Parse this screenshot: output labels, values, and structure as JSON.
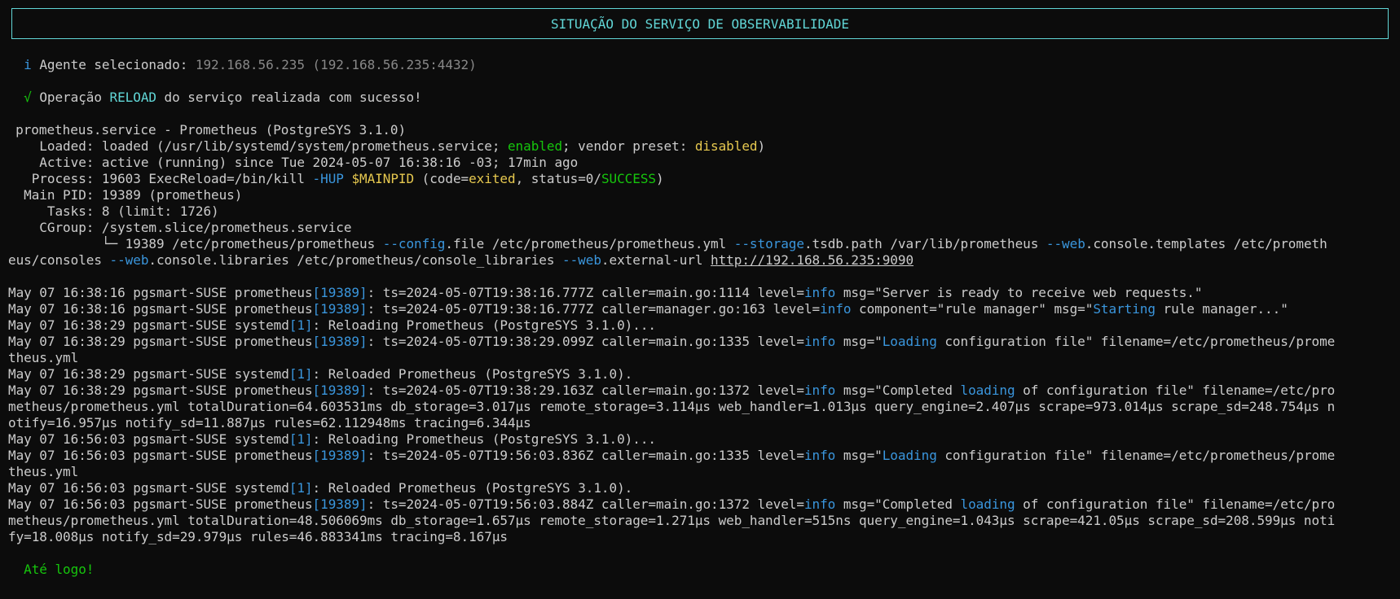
{
  "header": {
    "title": "SITUAÇÃO DO SERVIÇO DE OBSERVABILIDADE"
  },
  "info": {
    "icon": "i",
    "label": "Agente selecionado: ",
    "agent": "192.168.56.235 (192.168.56.235:4432)"
  },
  "success": {
    "icon": "√",
    "pre": "Operação ",
    "op": "RELOAD",
    "post": " do serviço realizada com sucesso!"
  },
  "status": {
    "dot": "●",
    "service_line": "prometheus.service - Prometheus (PostgreSYS 3.1.0)",
    "loaded_label": "    Loaded: ",
    "loaded_pre": "loaded (/usr/lib/systemd/system/prometheus.service; ",
    "loaded_enabled": "enabled",
    "loaded_mid": "; vendor preset: ",
    "loaded_preset": "disabled",
    "loaded_post": ")",
    "active_line": "    Active: active (running) since Tue 2024-05-07 16:38:16 -03; 17min ago",
    "process_pre": "   Process: 19603 ExecReload=/bin/kill ",
    "process_hup": "-HUP",
    "process_sp": " ",
    "process_var": "$MAINPID",
    "process_mid1": " (code=",
    "process_code": "exited",
    "process_mid2": ", status=0/",
    "process_status": "SUCCESS",
    "process_post": ")",
    "mainpid_line": "  Main PID: 19389 (prometheus)",
    "tasks_line": "     Tasks: 8 (limit: 1726)",
    "cgroup_line": "    CGroup: /system.slice/prometheus.service",
    "cmd_l1_a": "            └─ 19389 /etc/prometheus/prometheus ",
    "cmd_l1_b": "--config",
    "cmd_l1_c": ".file /etc/prometheus/prometheus.yml ",
    "cmd_l1_d": "--storage",
    "cmd_l1_e": ".tsdb.path /var/lib/prometheus ",
    "cmd_l1_f": "--web",
    "cmd_l1_g": ".console.templates /etc/prometh",
    "cmd_l2_a": "eus/consoles ",
    "cmd_l2_b": "--web",
    "cmd_l2_c": ".console.libraries /etc/prometheus/console_libraries ",
    "cmd_l2_d": "--web",
    "cmd_l2_e": ".external-url ",
    "cmd_url": "http://192.168.56.235:9090"
  },
  "log": {
    "l1_a": "May 07 16:38:16 pgsmart-SUSE prometheus",
    "l1_pid": "[19389]",
    "l1_b": ": ts=2024-05-07T19:38:16.777Z caller=main.go:1114 level=",
    "l1_lvl": "info",
    "l1_c": " msg=\"Server is ready to receive web requests.\"",
    "l2_a": "May 07 16:38:16 pgsmart-SUSE prometheus",
    "l2_pid": "[19389]",
    "l2_b": ": ts=2024-05-07T19:38:16.777Z caller=manager.go:163 level=",
    "l2_lvl": "info",
    "l2_c": " component=\"rule manager\" msg=\"",
    "l2_kw": "Starting",
    "l2_d": " rule manager...\"",
    "l3_a": "May 07 16:38:29 pgsmart-SUSE systemd",
    "l3_pid": "[1]",
    "l3_b": ": Reloading Prometheus (PostgreSYS 3.1.0)...",
    "l4_a": "May 07 16:38:29 pgsmart-SUSE prometheus",
    "l4_pid": "[19389]",
    "l4_b": ": ts=2024-05-07T19:38:29.099Z caller=main.go:1335 level=",
    "l4_lvl": "info",
    "l4_c": " msg=\"",
    "l4_kw": "Loading",
    "l4_d": " configuration file\" filename=/etc/prometheus/prome",
    "l4_wrap": "theus.yml",
    "l5_a": "May 07 16:38:29 pgsmart-SUSE systemd",
    "l5_pid": "[1]",
    "l5_b": ": Reloaded Prometheus (PostgreSYS 3.1.0).",
    "l6_a": "May 07 16:38:29 pgsmart-SUSE prometheus",
    "l6_pid": "[19389]",
    "l6_b": ": ts=2024-05-07T19:38:29.163Z caller=main.go:1372 level=",
    "l6_lvl": "info",
    "l6_c": " msg=\"Completed ",
    "l6_kw": "loading",
    "l6_d": " of configuration file\" filename=/etc/pro",
    "l6_wrap1": "metheus/prometheus.yml totalDuration=64.603531ms db_storage=3.017µs remote_storage=3.114µs web_handler=1.013µs query_engine=2.407µs scrape=973.014µs scrape_sd=248.754µs n",
    "l6_wrap2": "otify=16.957µs notify_sd=11.887µs rules=62.112948ms tracing=6.344µs",
    "l7_a": "May 07 16:56:03 pgsmart-SUSE systemd",
    "l7_pid": "[1]",
    "l7_b": ": Reloading Prometheus (PostgreSYS 3.1.0)...",
    "l8_a": "May 07 16:56:03 pgsmart-SUSE prometheus",
    "l8_pid": "[19389]",
    "l8_b": ": ts=2024-05-07T19:56:03.836Z caller=main.go:1335 level=",
    "l8_lvl": "info",
    "l8_c": " msg=\"",
    "l8_kw": "Loading",
    "l8_d": " configuration file\" filename=/etc/prometheus/prome",
    "l8_wrap": "theus.yml",
    "l9_a": "May 07 16:56:03 pgsmart-SUSE systemd",
    "l9_pid": "[1]",
    "l9_b": ": Reloaded Prometheus (PostgreSYS 3.1.0).",
    "l10_a": "May 07 16:56:03 pgsmart-SUSE prometheus",
    "l10_pid": "[19389]",
    "l10_b": ": ts=2024-05-07T19:56:03.884Z caller=main.go:1372 level=",
    "l10_lvl": "info",
    "l10_c": " msg=\"Completed ",
    "l10_kw": "loading",
    "l10_d": " of configuration file\" filename=/etc/pro",
    "l10_wrap1": "metheus/prometheus.yml totalDuration=48.506069ms db_storage=1.657µs remote_storage=1.271µs web_handler=515ns query_engine=1.043µs scrape=421.05µs scrape_sd=208.599µs noti",
    "l10_wrap2": "fy=18.008µs notify_sd=29.979µs rules=46.883341ms tracing=8.167µs"
  },
  "footer": {
    "goodbye": "Até logo!"
  },
  "colors": {
    "background": "#0c0c0c",
    "foreground": "#cccccc",
    "accent_cyan": "#61d6d6",
    "pid_blue": "#3a96dd",
    "success_green": "#16c60c",
    "warning_yellow": "#f9f1a5"
  }
}
